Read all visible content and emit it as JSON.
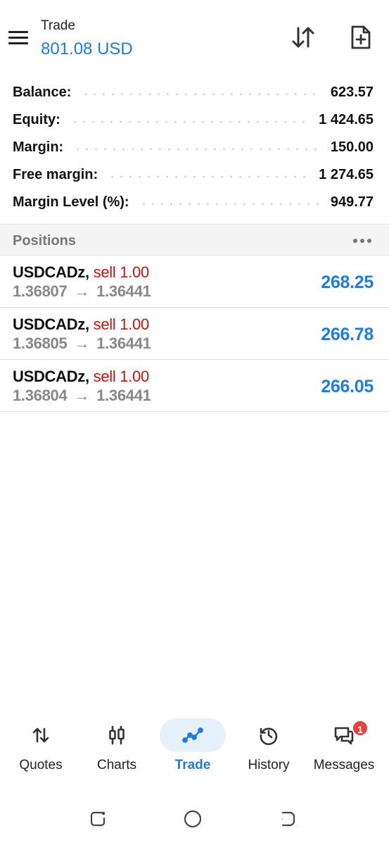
{
  "header": {
    "title": "Trade",
    "balance": "801.08 USD"
  },
  "summary": [
    {
      "label": "Balance:",
      "value": "623.57"
    },
    {
      "label": "Equity:",
      "value": "1 424.65"
    },
    {
      "label": "Margin:",
      "value": "150.00"
    },
    {
      "label": "Free margin:",
      "value": "1 274.65"
    },
    {
      "label": "Margin Level (%):",
      "value": "949.77"
    }
  ],
  "positions": {
    "title": "Positions",
    "items": [
      {
        "symbol": "USDCADz",
        "side": "sell 1.00",
        "open_price": "1.36807",
        "current_price": "1.36441",
        "profit": "268.25"
      },
      {
        "symbol": "USDCADz",
        "side": "sell 1.00",
        "open_price": "1.36805",
        "current_price": "1.36441",
        "profit": "266.78"
      },
      {
        "symbol": "USDCADz",
        "side": "sell 1.00",
        "open_price": "1.36804",
        "current_price": "1.36441",
        "profit": "266.05"
      }
    ]
  },
  "nav": {
    "items": [
      {
        "label": "Quotes",
        "icon": "sort-arrows-icon"
      },
      {
        "label": "Charts",
        "icon": "candlestick-icon"
      },
      {
        "label": "Trade",
        "icon": "trend-line-icon",
        "active": true
      },
      {
        "label": "History",
        "icon": "history-icon"
      },
      {
        "label": "Messages",
        "icon": "chat-icon",
        "badge": "1"
      }
    ]
  },
  "colors": {
    "accent": "#1f7ce0",
    "sell": "#cc1111",
    "badge": "#e8413c"
  }
}
